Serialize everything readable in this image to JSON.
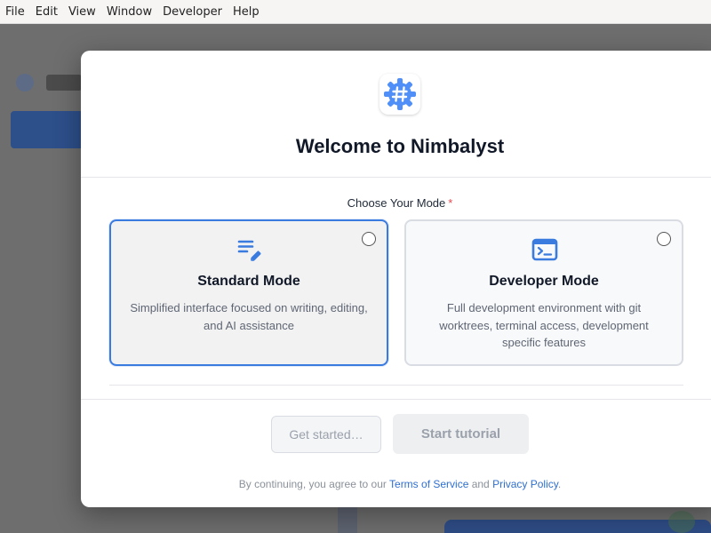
{
  "menubar": {
    "items": [
      "File",
      "Edit",
      "View",
      "Window",
      "Developer",
      "Help"
    ]
  },
  "modal": {
    "app_icon": "gear-hash-icon",
    "title": "Welcome to Nimbalyst",
    "mode_label": "Choose Your Mode",
    "required_mark": "*",
    "modes": [
      {
        "icon": "document-edit-icon",
        "title": "Standard Mode",
        "description": "Simplified interface focused on writing, editing, and AI assistance",
        "selected": true
      },
      {
        "icon": "terminal-icon",
        "title": "Developer Mode",
        "description": "Full development environment with git worktrees, terminal access, development specific features",
        "selected": false
      }
    ],
    "buttons": {
      "get_started": "Get started…",
      "start_tutorial": "Start tutorial"
    },
    "legal": {
      "prefix": "By continuing, you agree to our ",
      "terms": "Terms of Service",
      "and": " and ",
      "privacy": "Privacy Policy",
      "suffix": "."
    }
  },
  "colors": {
    "accent": "#3a7be0",
    "icon_blue": "#4f8ff7",
    "link": "#2f6fd1",
    "required": "#e5484d"
  }
}
